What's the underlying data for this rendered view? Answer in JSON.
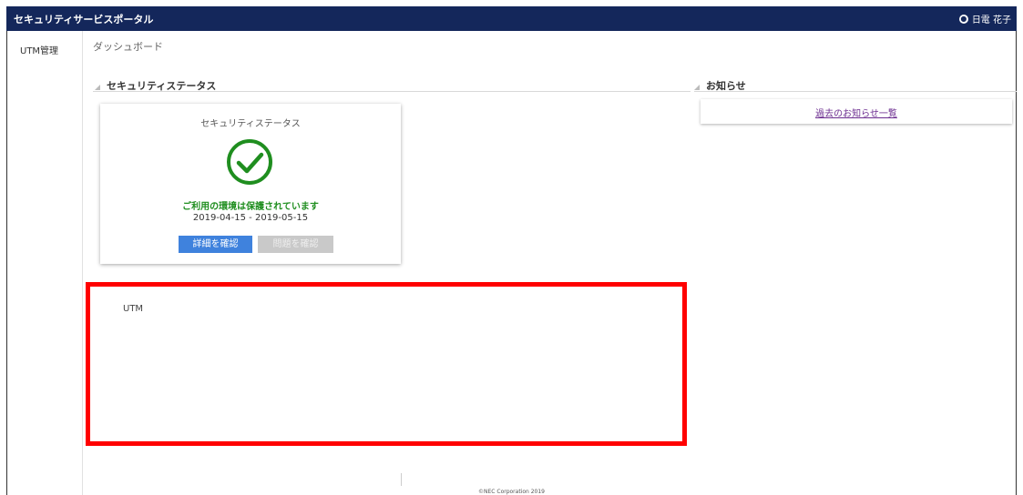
{
  "header": {
    "app_title": "セキュリティサービスポータル",
    "user_icon": "user-icon",
    "user_name": "日電 花子"
  },
  "sidebar": {
    "items": [
      {
        "label": "UTM管理"
      }
    ]
  },
  "breadcrumb": "ダッシュボード",
  "status_section": {
    "heading": "セキュリティステータス",
    "card": {
      "title": "セキュリティステータス",
      "icon": "check-circle-icon",
      "message": "ご利用の環境は保護されています",
      "dates": "2019-04-15 - 2019-05-15",
      "detail_button": "詳細を確認",
      "issue_button": "問題を確認"
    }
  },
  "news_section": {
    "heading": "お知らせ",
    "past_link": "過去のお知らせ一覧"
  },
  "utm_panel": {
    "label": "UTM"
  },
  "footer": {
    "copyright": "©NEC Corporation 2019"
  },
  "colors": {
    "header_bg": "#14275b",
    "status_ok": "#1f8e1f",
    "primary_button": "#3f82dd",
    "disabled_button": "#c9c9c9",
    "highlight_border": "#ff0000",
    "link": "#6b2c8f"
  }
}
